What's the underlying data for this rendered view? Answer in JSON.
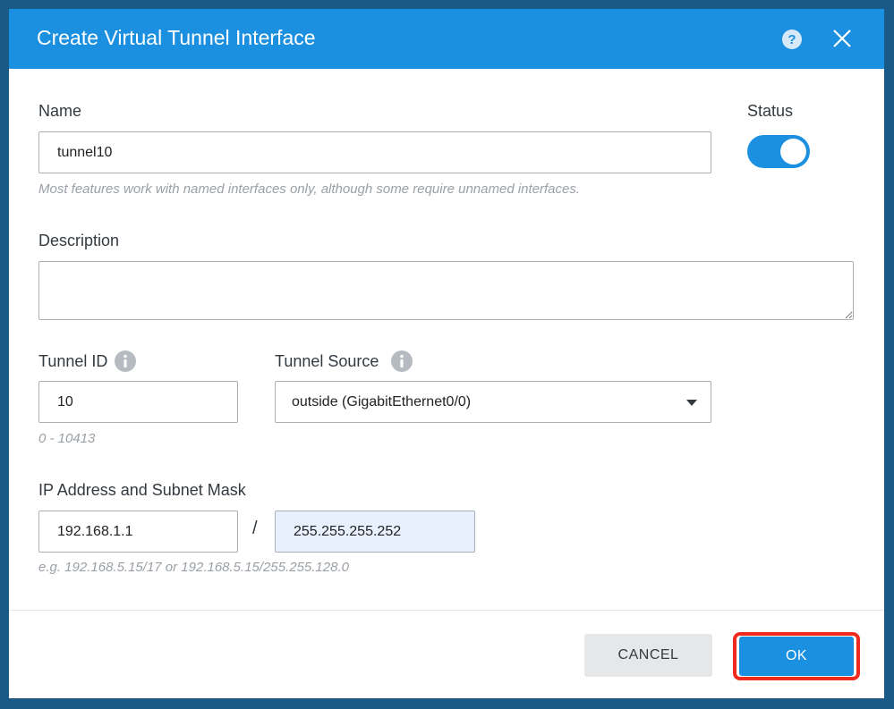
{
  "dialog": {
    "title": "Create Virtual Tunnel Interface",
    "help_icon": "help-circle-icon",
    "close_icon": "close-icon"
  },
  "name_field": {
    "label": "Name",
    "value": "tunnel10",
    "hint": "Most features work with named interfaces only, although some require unnamed interfaces."
  },
  "status": {
    "label": "Status",
    "enabled": true
  },
  "description": {
    "label": "Description",
    "value": ""
  },
  "tunnel_id": {
    "label": "Tunnel ID",
    "value": "10",
    "hint": "0 - 10413"
  },
  "tunnel_source": {
    "label": "Tunnel Source",
    "selected": "outside (GigabitEthernet0/0)"
  },
  "ip": {
    "label": "IP Address and Subnet Mask",
    "address": "192.168.1.1",
    "separator": "/",
    "mask": "255.255.255.252",
    "hint": "e.g. 192.168.5.15/17 or 192.168.5.15/255.255.128.0"
  },
  "footer": {
    "cancel_label": "CANCEL",
    "ok_label": "OK"
  },
  "colors": {
    "accent": "#1b8fe0",
    "highlight": "#f02a1e"
  }
}
